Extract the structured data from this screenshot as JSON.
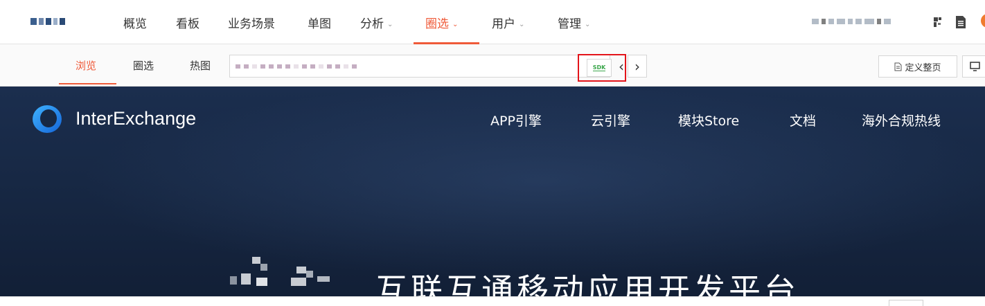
{
  "topnav": {
    "items": [
      {
        "label": "概览",
        "dropdown": false
      },
      {
        "label": "看板",
        "dropdown": false
      },
      {
        "label": "业务场景",
        "dropdown": false
      },
      {
        "label": "单图",
        "dropdown": false
      },
      {
        "label": "分析",
        "dropdown": true
      },
      {
        "label": "圈选",
        "dropdown": true,
        "active": true
      },
      {
        "label": "用户",
        "dropdown": true
      },
      {
        "label": "管理",
        "dropdown": true
      }
    ],
    "chevron": "⌄",
    "icons": [
      "puzzle-icon",
      "document-icon",
      "avatar"
    ]
  },
  "subbar": {
    "tabs": [
      {
        "label": "浏览",
        "active": true
      },
      {
        "label": "圈选",
        "active": false
      },
      {
        "label": "热图",
        "active": false
      }
    ],
    "sdk_label": "SDK",
    "back_glyph": "‹",
    "forward_glyph": "›",
    "define_page_label": "定义整页"
  },
  "hero": {
    "brand": "InterExchange",
    "nav": [
      "APP引擎",
      "云引擎",
      "模块Store",
      "文档",
      "海外合规热线"
    ],
    "title": "互联互通移动应用开发平台"
  },
  "colors": {
    "accent": "#ef5a39",
    "highlight_box": "#e3141a",
    "sdk_green": "#3aa64b",
    "hero_bg": "#172844"
  }
}
